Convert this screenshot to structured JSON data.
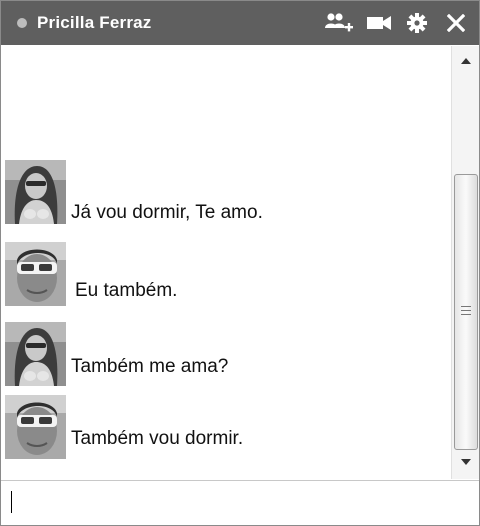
{
  "header": {
    "contact_name": "Pricilla Ferraz",
    "status": "online",
    "icons": [
      "add-people-icon",
      "video-call-icon",
      "gear-icon",
      "close-icon"
    ]
  },
  "messages": [
    {
      "sender": "Pricilla Ferraz",
      "avatar": "avatar-pricilla",
      "text": "Já vou dormir, Te amo."
    },
    {
      "sender": "me",
      "avatar": "avatar-me",
      "text": "Eu também."
    },
    {
      "sender": "Pricilla Ferraz",
      "avatar": "avatar-pricilla",
      "text": "Também me ama?"
    },
    {
      "sender": "me",
      "avatar": "avatar-me",
      "text": "Também vou dormir."
    }
  ],
  "composer": {
    "value": ""
  },
  "colors": {
    "titlebar": "#5f5f5f",
    "title_text": "#ffffff",
    "background": "#ffffff"
  }
}
